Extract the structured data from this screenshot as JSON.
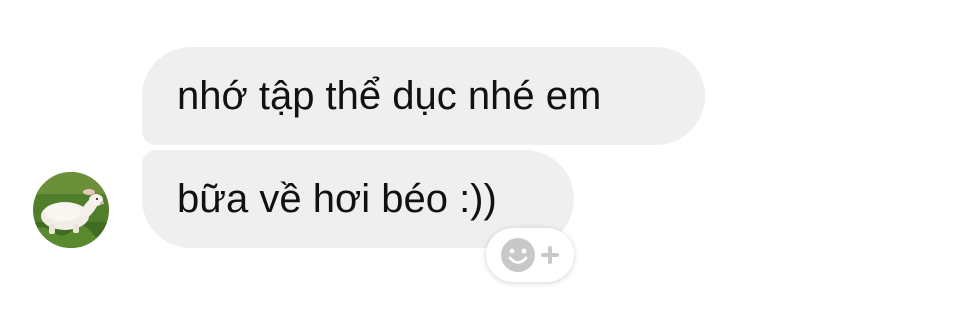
{
  "conversation": {
    "messages": [
      {
        "text": "nhớ tập thể dục nhé em"
      },
      {
        "text": "bữa về hơi béo :))"
      }
    ],
    "sender": {
      "avatar_icon": "goat-avatar-icon"
    },
    "reaction_button": {
      "icons": [
        "smiley-icon",
        "plus-icon"
      ],
      "color": "#c8c8c8"
    }
  },
  "colors": {
    "bubble_background": "#efefef",
    "text": "#111111",
    "background": "#ffffff"
  }
}
